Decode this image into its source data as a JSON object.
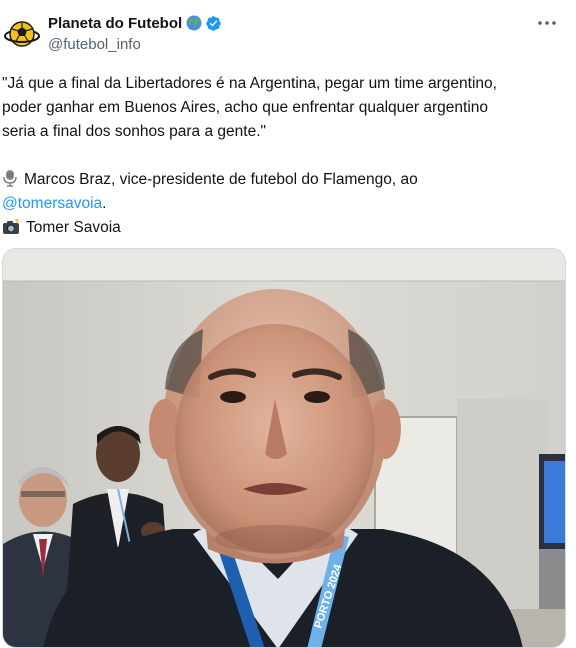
{
  "account": {
    "name": "Planeta do Futebol",
    "handle": "@futebol_info",
    "verified_color": "#1d9bf0",
    "icons": [
      "globe-emoji-icon",
      "verified-badge-icon",
      "more-options-icon"
    ]
  },
  "tweet": {
    "quote_line1": "\"Já que a final da Libertadores é na Argentina, pegar um time argentino,",
    "quote_line2": "poder ganhar em Buenos Aires, acho que enfrentar qualquer argentino",
    "quote_line3": "seria a final dos sonhos para a gente.\"",
    "credit_text": "Marcos Braz, vice-presidente de futebol do Flamengo, ao",
    "mention": "@tomersavoia",
    "mention_suffix": ".",
    "photo_credit": "Tomer Savoia",
    "link_color": "#1d9bf0"
  },
  "media": {
    "lanyard_text": "PORTO 2024"
  }
}
